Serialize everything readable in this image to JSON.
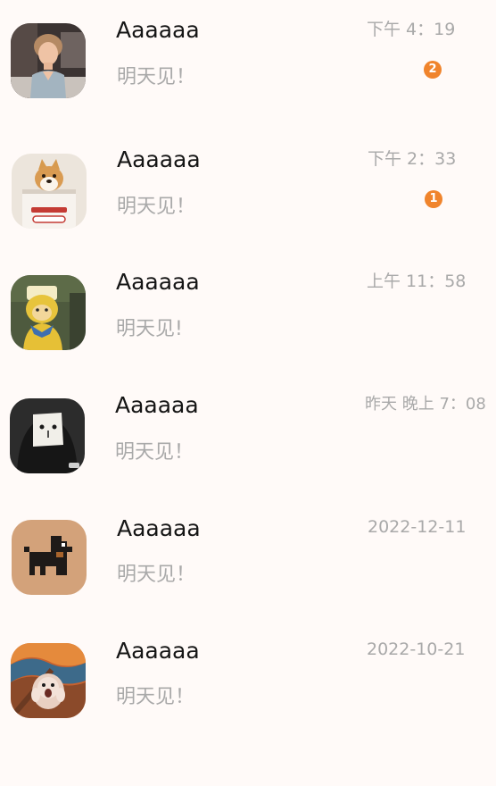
{
  "chats": [
    {
      "avatar": "woman-photo-avatar",
      "name": "Aaaaaa",
      "preview": "明天见！",
      "time": "下午 4：19",
      "badge": "2"
    },
    {
      "avatar": "shiba-dog-avatar",
      "name": "Aaaaaa",
      "preview": "明天见！",
      "time": "下午 2：33",
      "badge": "1"
    },
    {
      "avatar": "yellow-toy-avatar",
      "name": "Aaaaaa",
      "preview": "明天见!",
      "time": "上午 11：58"
    },
    {
      "avatar": "paper-mask-avatar",
      "name": "Aaaaaa",
      "preview": "明天见！",
      "time": "昨天 晚上 7：08"
    },
    {
      "avatar": "pixel-dog-avatar",
      "name": "Aaaaaa",
      "preview": "明天见！",
      "time": "2022-12-11"
    },
    {
      "avatar": "scream-hamster-avatar",
      "name": "Aaaaaa",
      "preview": "明天见！",
      "time": "2022-10-21"
    }
  ],
  "colors": {
    "background": "#fffaf8",
    "name_text": "#151515",
    "secondary_text": "#a9a9a9",
    "badge": "#f0842c"
  }
}
